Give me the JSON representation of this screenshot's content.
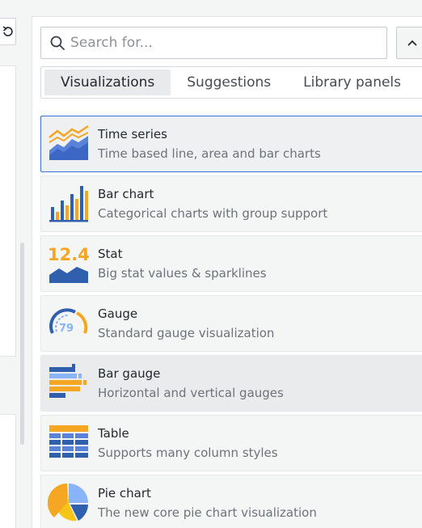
{
  "left": {
    "refresh_icon": "refresh-icon"
  },
  "search": {
    "placeholder": "Search for...",
    "value": ""
  },
  "tabs": [
    {
      "label": "Visualizations",
      "active": true
    },
    {
      "label": "Suggestions",
      "active": false
    },
    {
      "label": "Library panels",
      "active": false
    }
  ],
  "visualizations": [
    {
      "name": "Time series",
      "description": "Time based line, area and bar charts",
      "icon": "time-series-icon"
    },
    {
      "name": "Bar chart",
      "description": "Categorical charts with group support",
      "icon": "bar-chart-icon"
    },
    {
      "name": "Stat",
      "description": "Big stat values & sparklines",
      "icon": "stat-icon",
      "icon_text": "12.4"
    },
    {
      "name": "Gauge",
      "description": "Standard gauge visualization",
      "icon": "gauge-icon",
      "icon_text": "79"
    },
    {
      "name": "Bar gauge",
      "description": "Horizontal and vertical gauges",
      "icon": "bar-gauge-icon"
    },
    {
      "name": "Table",
      "description": "Supports many column styles",
      "icon": "table-icon"
    },
    {
      "name": "Pie chart",
      "description": "The new core pie chart visualization",
      "icon": "pie-chart-icon"
    }
  ],
  "colors": {
    "accent_blue": "#3d71d9",
    "icon_orange": "#f5a623",
    "icon_dark_blue": "#2f5fad",
    "icon_light_blue": "#8ab4f8"
  }
}
